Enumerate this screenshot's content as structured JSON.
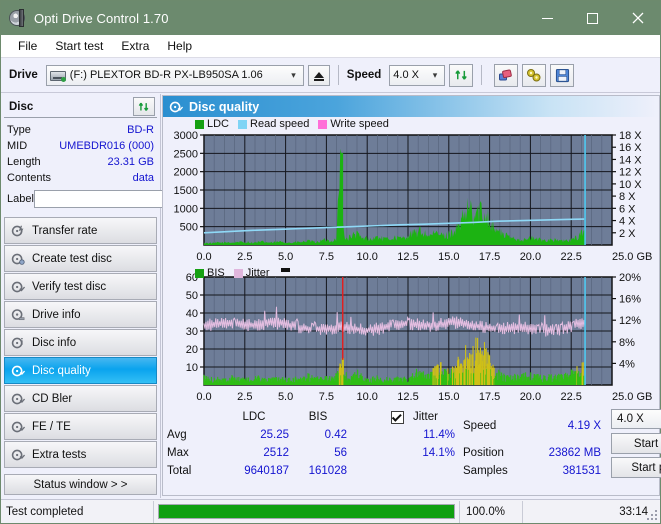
{
  "window": {
    "title": "Opti Drive Control 1.70",
    "icon": "optical-disc-icon",
    "minimize": "–",
    "maximize": "□",
    "close": "×"
  },
  "menu": {
    "items": [
      "File",
      "Start test",
      "Extra",
      "Help"
    ]
  },
  "toolbar": {
    "drive_label": "Drive",
    "drive_value": "(F:)   PLEXTOR BD-R  PX-LB950SA 1.06",
    "eject_icon": "eject-icon",
    "speed_label": "Speed",
    "speed_value": "4.0 X",
    "refresh_icon": "refresh-icon",
    "eraser_icon": "eraser-icon",
    "plugin_icon": "plugin-icon",
    "save_icon": "save-icon"
  },
  "sidebar": {
    "disc_header": "Disc",
    "refresh_icon": "refresh-icon",
    "info": [
      {
        "key": "Type",
        "value": "BD-R"
      },
      {
        "key": "MID",
        "value": "UMEBDR016 (000)"
      },
      {
        "key": "Length",
        "value": "23.31 GB"
      },
      {
        "key": "Contents",
        "value": "data"
      }
    ],
    "label_key": "Label",
    "label_value": "",
    "label_placeholder": "",
    "label_button_icon": "disc-icon",
    "nav": [
      {
        "label": "Transfer rate",
        "icon": "disc-icon",
        "active": false
      },
      {
        "label": "Create test disc",
        "icon": "disc-icon",
        "active": false
      },
      {
        "label": "Verify test disc",
        "icon": "disc-icon",
        "active": false
      },
      {
        "label": "Drive info",
        "icon": "disc-icon",
        "active": false
      },
      {
        "label": "Disc info",
        "icon": "disc-icon",
        "active": false
      },
      {
        "label": "Disc quality",
        "icon": "disc-icon",
        "active": true
      },
      {
        "label": "CD Bler",
        "icon": "disc-icon",
        "active": false
      },
      {
        "label": "FE / TE",
        "icon": "disc-icon",
        "active": false
      },
      {
        "label": "Extra tests",
        "icon": "disc-icon",
        "active": false
      }
    ],
    "status_window": "Status window > >"
  },
  "panel": {
    "title": "Disc quality",
    "icon": "disc-quality-icon"
  },
  "stats": {
    "col_ldc": "LDC",
    "col_bis": "BIS",
    "jitter_label": "Jitter",
    "jitter_checked": true,
    "rows": [
      {
        "name": "Avg",
        "ldc": "25.25",
        "bis": "0.42",
        "jitter": "11.4%"
      },
      {
        "name": "Max",
        "ldc": "2512",
        "bis": "56",
        "jitter": "14.1%"
      },
      {
        "name": "Total",
        "ldc": "9640187",
        "bis": "161028",
        "jitter": ""
      }
    ],
    "speed_label": "Speed",
    "speed_value": "4.19 X",
    "position_label": "Position",
    "position_value": "23862 MB",
    "samples_label": "Samples",
    "samples_value": "381531",
    "speed_select": "4.0 X",
    "start_full": "Start full",
    "start_part": "Start part"
  },
  "statusbar": {
    "message": "Test completed",
    "progress_percent": 100.0,
    "progress_text": "100.0%",
    "elapsed": "33:14"
  },
  "colors": {
    "titlebar": "#6c8a6e",
    "accent": "#1789c4",
    "ldc_green": "#16a012",
    "read_speed": "#7fd4f5",
    "write_speed": "#ff6fd8",
    "bis_green": "#16a012",
    "jitter_pink": "#e0b6dd",
    "value_blue": "#1414d0",
    "plot_bg": "#6e7d98",
    "progress_green": "#11a011"
  },
  "chart_data": [
    {
      "type": "area",
      "id": "ldc-chart",
      "title": "LDC / Read speed / Write speed",
      "xlabel": "GB",
      "ylabel": "LDC",
      "xlim": [
        0,
        25.0
      ],
      "xticks": [
        0.0,
        2.5,
        5.0,
        7.5,
        10.0,
        12.5,
        15.0,
        17.5,
        20.0,
        22.5,
        25.0
      ],
      "xtick_labels": [
        "0.0",
        "2.5",
        "5.0",
        "7.5",
        "10.0",
        "12.5",
        "15.0",
        "17.5",
        "20.0",
        "22.5",
        "25.0 GB"
      ],
      "ylim": [
        0,
        3000
      ],
      "yticks": [
        500,
        1000,
        1500,
        2000,
        2500,
        3000
      ],
      "ytick_labels": [
        "500",
        "1000",
        "1500",
        "2000",
        "2500",
        "3000"
      ],
      "y2label": "X",
      "y2lim": [
        0,
        18
      ],
      "y2ticks": [
        2,
        4,
        6,
        8,
        10,
        12,
        14,
        16,
        18
      ],
      "y2tick_labels": [
        "2 X",
        "4 X",
        "6 X",
        "8 X",
        "10 X",
        "12 X",
        "14 X",
        "16 X",
        "18 X"
      ],
      "grid": true,
      "legend": [
        {
          "name": "LDC",
          "color": "#16a012"
        },
        {
          "name": "Read speed",
          "color": "#7fd4f5"
        },
        {
          "name": "Write speed",
          "color": "#ff6fd8"
        }
      ],
      "series": [
        {
          "name": "LDC",
          "color": "#16a012",
          "x": [
            0.0,
            0.3,
            0.6,
            0.9,
            1.2,
            1.5,
            1.8,
            2.1,
            2.4,
            2.7,
            3.0,
            3.3,
            3.6,
            3.9,
            4.2,
            4.5,
            4.8,
            5.1,
            5.4,
            5.7,
            6.0,
            6.3,
            6.6,
            6.9,
            7.2,
            7.5,
            7.8,
            8.1,
            8.4,
            8.5,
            8.6,
            8.8,
            9.1,
            9.4,
            9.7,
            10.0,
            10.3,
            10.6,
            10.9,
            11.2,
            11.5,
            11.8,
            12.1,
            12.4,
            12.7,
            13.0,
            13.3,
            13.6,
            13.9,
            14.2,
            14.5,
            14.8,
            15.1,
            15.4,
            15.7,
            15.9,
            16.1,
            16.3,
            16.5,
            16.7,
            16.9,
            17.1,
            17.3,
            17.5,
            17.7,
            17.9,
            18.2,
            18.5,
            18.8,
            19.1,
            19.4,
            19.7,
            20.0,
            20.3,
            20.6,
            20.9,
            21.2,
            21.5,
            21.8,
            22.1,
            22.4,
            22.7,
            23.0,
            23.3
          ],
          "y": [
            60,
            55,
            50,
            70,
            60,
            80,
            65,
            90,
            70,
            85,
            60,
            75,
            90,
            70,
            65,
            80,
            95,
            70,
            60,
            85,
            75,
            110,
            95,
            80,
            120,
            140,
            110,
            160,
            2512,
            700,
            230,
            180,
            260,
            300,
            170,
            200,
            150,
            230,
            180,
            160,
            190,
            210,
            170,
            250,
            300,
            340,
            380,
            300,
            260,
            320,
            290,
            250,
            330,
            420,
            520,
            760,
            900,
            1050,
            700,
            860,
            980,
            760,
            1020,
            620,
            560,
            420,
            330,
            260,
            200,
            180,
            160,
            140,
            200,
            170,
            150,
            130,
            160,
            140,
            120,
            110,
            130,
            170,
            280,
            420
          ]
        },
        {
          "name": "Read speed",
          "color": "#7fd4f5",
          "x": [
            0.0,
            1.5,
            3.0,
            4.5,
            6.0,
            7.5,
            9.0,
            10.5,
            12.0,
            13.5,
            15.0,
            16.5,
            18.0,
            19.5,
            21.0,
            22.5,
            23.3
          ],
          "y_x_speed": [
            2.0,
            2.2,
            2.4,
            2.55,
            2.7,
            2.85,
            3.0,
            3.15,
            3.3,
            3.4,
            3.55,
            3.7,
            3.9,
            4.0,
            4.1,
            4.2,
            4.25
          ]
        }
      ],
      "cursor_line_x": 23.35,
      "cursor_line_color": "#4fc9ef"
    },
    {
      "type": "area",
      "id": "bis-jitter-chart",
      "title": "BIS / Jitter",
      "xlabel": "GB",
      "ylabel": "BIS",
      "xlim": [
        0,
        25.0
      ],
      "xticks": [
        0.0,
        2.5,
        5.0,
        7.5,
        10.0,
        12.5,
        15.0,
        17.5,
        20.0,
        22.5,
        25.0
      ],
      "xtick_labels": [
        "0.0",
        "2.5",
        "5.0",
        "7.5",
        "10.0",
        "12.5",
        "15.0",
        "17.5",
        "20.0",
        "22.5",
        "25.0 GB"
      ],
      "ylim": [
        0,
        60
      ],
      "yticks": [
        10,
        20,
        30,
        40,
        50,
        60
      ],
      "ytick_labels": [
        "10",
        "20",
        "30",
        "40",
        "50",
        "60"
      ],
      "y2label": "%",
      "y2lim": [
        0,
        20
      ],
      "y2ticks": [
        4,
        8,
        12,
        16,
        20
      ],
      "y2tick_labels": [
        "4%",
        "8%",
        "12%",
        "16%",
        "20%"
      ],
      "grid": true,
      "legend": [
        {
          "name": "BIS",
          "color": "#16a012"
        },
        {
          "name": "Jitter",
          "color": "#e0b6dd"
        }
      ],
      "series": [
        {
          "name": "BIS",
          "color": "#16a012",
          "x": [
            0.0,
            0.4,
            0.8,
            1.2,
            1.6,
            2.0,
            2.4,
            2.8,
            3.2,
            3.6,
            4.0,
            4.4,
            4.8,
            5.2,
            5.6,
            6.0,
            6.4,
            6.8,
            7.2,
            7.6,
            8.0,
            8.4,
            8.5,
            8.6,
            9.0,
            9.4,
            9.8,
            10.2,
            10.6,
            11.0,
            11.4,
            11.8,
            12.2,
            12.6,
            13.0,
            13.4,
            13.8,
            14.2,
            14.6,
            15.0,
            15.3,
            15.6,
            15.9,
            16.1,
            16.3,
            16.5,
            16.7,
            16.9,
            17.1,
            17.3,
            17.5,
            17.8,
            18.2,
            18.6,
            19.0,
            19.4,
            19.8,
            20.2,
            20.6,
            21.0,
            21.4,
            21.8,
            22.2,
            22.6,
            23.0,
            23.3
          ],
          "y": [
            4,
            3,
            3.5,
            3,
            4,
            3.2,
            3,
            2.8,
            4,
            3,
            2.6,
            3.2,
            3,
            2.8,
            3.4,
            3,
            4.6,
            3,
            4,
            3.6,
            3.2,
            15,
            14,
            6,
            3.4,
            6,
            3.2,
            3,
            3.6,
            3,
            3.2,
            3.4,
            3,
            4,
            6.2,
            5,
            6,
            7.5,
            8.8,
            6,
            8,
            12,
            14,
            16,
            13,
            15,
            20,
            17,
            19,
            14,
            12,
            7,
            5,
            4,
            4.5,
            4,
            5,
            4.4,
            4,
            4.2,
            4,
            4.4,
            5,
            6,
            8,
            9
          ]
        },
        {
          "name": "Jitter",
          "color": "#e0b6dd",
          "avg_percent": 11.4,
          "max_percent": 14.1,
          "baseline_y": 34,
          "note": "noisy trace oscillating around 33-36 on left scale (approx 11-12%)"
        }
      ],
      "cursor_line_x": 23.35,
      "cursor_line_color": "#4fc9ef",
      "marker_line_x": 8.5,
      "marker_line_color": "#e02020"
    }
  ]
}
